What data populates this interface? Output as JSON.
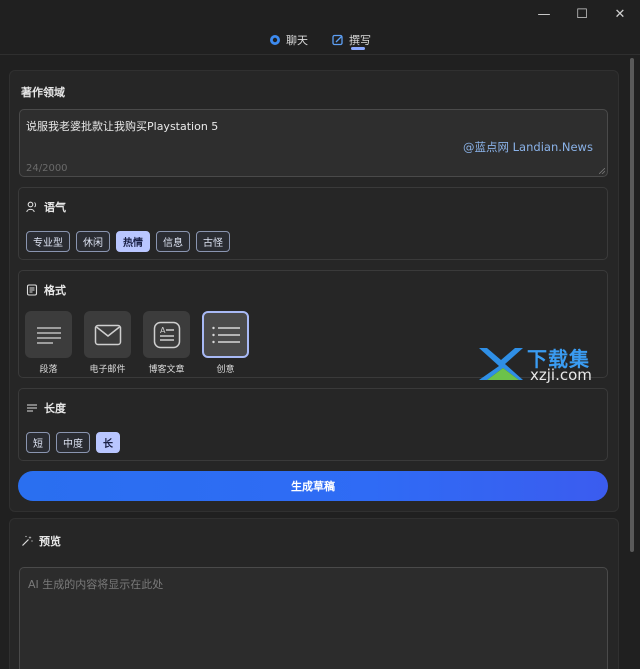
{
  "window": {
    "minimize_glyph": "—",
    "maximize_glyph": "☐",
    "close_glyph": "✕"
  },
  "tabs": [
    {
      "label": "聊天",
      "icon": "chat-icon",
      "active": false
    },
    {
      "label": "撰写",
      "icon": "compose-icon",
      "active": true
    }
  ],
  "compose": {
    "field_title": "著作领域",
    "input_value": "说服我老婆批款让我购买Playstation 5",
    "counter": "24/2000",
    "watermark": "@蓝点网 Landian.News"
  },
  "tone": {
    "title": "语气",
    "icon": "people-icon",
    "options": [
      "专业型",
      "休闲",
      "热情",
      "信息",
      "古怪"
    ],
    "selected": "热情"
  },
  "format": {
    "title": "格式",
    "icon": "document-icon",
    "options": [
      {
        "label": "段落",
        "icon": "paragraph-icon"
      },
      {
        "label": "电子邮件",
        "icon": "mail-icon"
      },
      {
        "label": "博客文章",
        "icon": "blog-icon"
      },
      {
        "label": "创意",
        "icon": "list-icon"
      }
    ],
    "selected": "创意"
  },
  "length": {
    "title": "长度",
    "icon": "lines-icon",
    "options": [
      "短",
      "中度",
      "长"
    ],
    "selected": "长"
  },
  "generate_button": "生成草稿",
  "preview": {
    "title": "预览",
    "icon": "magic-wand-icon",
    "placeholder": "AI 生成的内容将显示在此处"
  },
  "site_watermark": {
    "top": "下载集",
    "bottom": "xzji.com"
  },
  "colors": {
    "accent": "#2f6bf5",
    "chip_selected": "#b9c6ff",
    "background": "#202020"
  }
}
